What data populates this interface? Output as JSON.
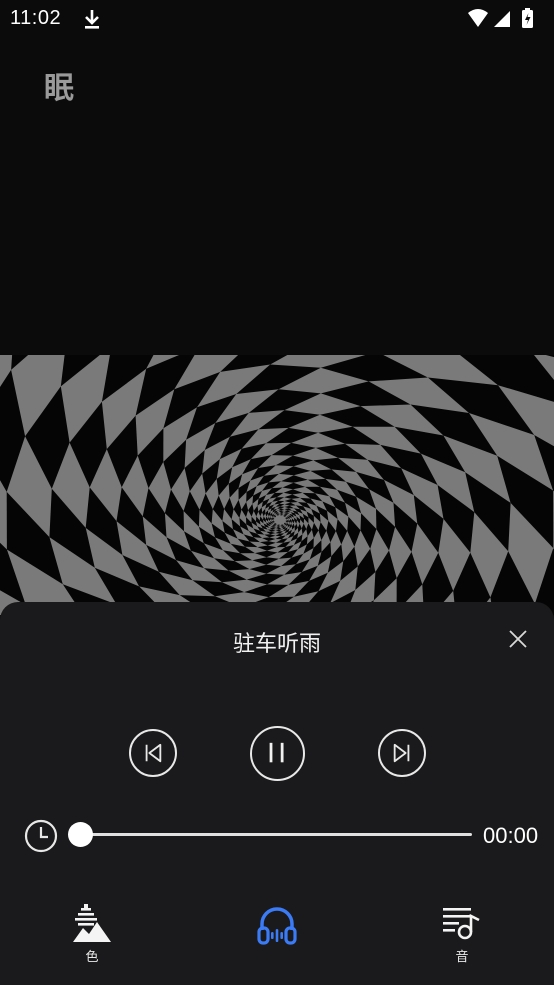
{
  "status_bar": {
    "time": "11:02"
  },
  "page": {
    "title": "眠"
  },
  "player": {
    "track_title": "驻车听雨",
    "elapsed": "00:00",
    "progress": 0
  },
  "bottom_nav": {
    "items": [
      {
        "label": "色",
        "icon": "scenery-icon"
      },
      {
        "label": "",
        "icon": "headphones-icon",
        "active": true
      },
      {
        "label": "音",
        "icon": "music-playlist-icon"
      }
    ]
  },
  "colors": {
    "accent": "#3b7bf6",
    "background": "#0b0b0c",
    "sheet": "#1a1a1c"
  }
}
